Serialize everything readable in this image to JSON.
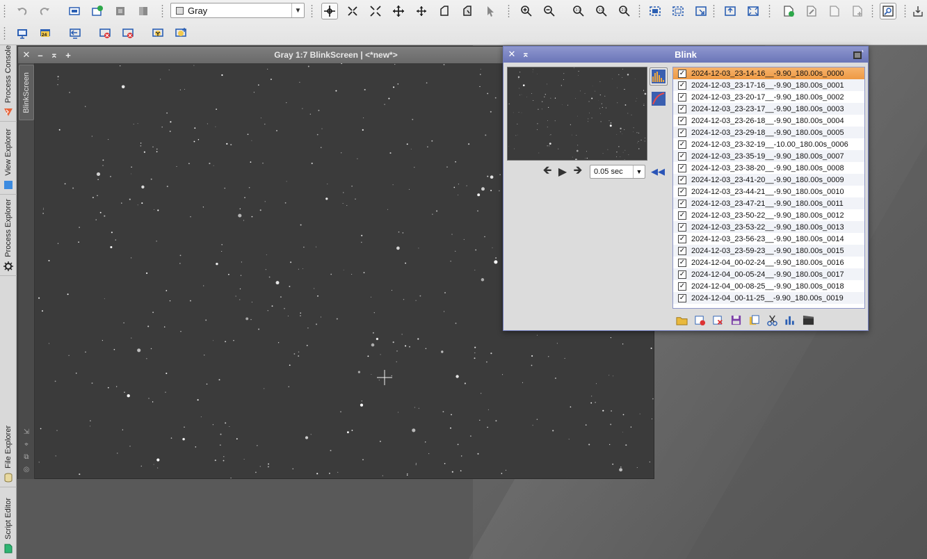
{
  "toolbar": {
    "color_mode": "Gray"
  },
  "left_dock": {
    "tabs": [
      "Process Console",
      "View Explorer",
      "Process Explorer",
      "File Explorer",
      "Script Editor"
    ]
  },
  "image_window": {
    "title": "Gray 1:7 BlinkScreen | <*new*>",
    "view_name": "BlinkScreen"
  },
  "blink": {
    "title": "Blink",
    "speed": "0.05 sec",
    "files": [
      "2024-12-03_23-14-16__-9.90_180.00s_0000",
      "2024-12-03_23-17-16__-9.90_180.00s_0001",
      "2024-12-03_23-20-17__-9.90_180.00s_0002",
      "2024-12-03_23-23-17__-9.90_180.00s_0003",
      "2024-12-03_23-26-18__-9.90_180.00s_0004",
      "2024-12-03_23-29-18__-9.90_180.00s_0005",
      "2024-12-03_23-32-19__-10.00_180.00s_0006",
      "2024-12-03_23-35-19__-9.90_180.00s_0007",
      "2024-12-03_23-38-20__-9.90_180.00s_0008",
      "2024-12-03_23-41-20__-9.90_180.00s_0009",
      "2024-12-03_23-44-21__-9.90_180.00s_0010",
      "2024-12-03_23-47-21__-9.90_180.00s_0011",
      "2024-12-03_23-50-22__-9.90_180.00s_0012",
      "2024-12-03_23-53-22__-9.90_180.00s_0013",
      "2024-12-03_23-56-23__-9.90_180.00s_0014",
      "2024-12-03_23-59-23__-9.90_180.00s_0015",
      "2024-12-04_00-02-24__-9.90_180.00s_0016",
      "2024-12-04_00-05-24__-9.90_180.00s_0017",
      "2024-12-04_00-08-25__-9.90_180.00s_0018",
      "2024-12-04_00-11-25__-9.90_180.00s_0019"
    ],
    "selected_index": 0,
    "accent": "#ee9a44",
    "title_color": "#6a75b8"
  }
}
